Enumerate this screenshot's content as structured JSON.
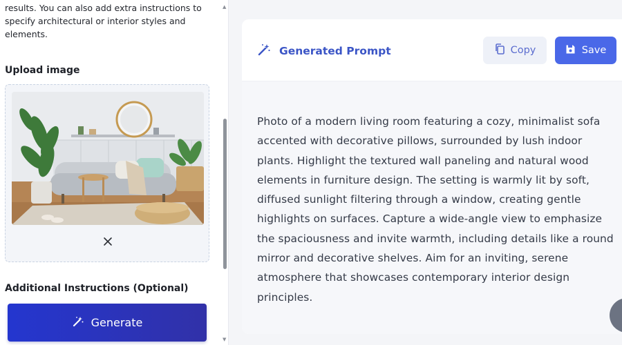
{
  "sidebar": {
    "intro_text": "results. You can also add extra instructions to specify architectural or interior styles and elements.",
    "upload_label": "Upload image",
    "additional_label": "Additional Instructions (Optional)",
    "generate_label": "Generate"
  },
  "prompt_card": {
    "title": "Generated Prompt",
    "copy_label": "Copy",
    "save_label": "Save",
    "prompt_text": "Photo of a modern living room featuring a cozy, minimalist sofa accented with decorative pillows, surrounded by lush indoor plants. Highlight the textured wall paneling and natural wood elements in furniture design. The setting is warmly lit by soft, diffused sunlight filtering through a window, creating gentle highlights on surfaces. Capture a wide-angle view to emphasize the spaciousness and invite warmth, including details like a round mirror and decorative shelves. Aim for an inviting, serene atmosphere that showcases contemporary interior design principles."
  },
  "colors": {
    "accent": "#4a68e8",
    "generate_gradient_start": "#2436cf",
    "title_blue": "#3b55c6"
  },
  "icons": {
    "generate": "magic-wand-icon",
    "title": "magic-wand-icon",
    "copy": "copy-icon",
    "save": "save-icon",
    "remove": "close-icon"
  }
}
